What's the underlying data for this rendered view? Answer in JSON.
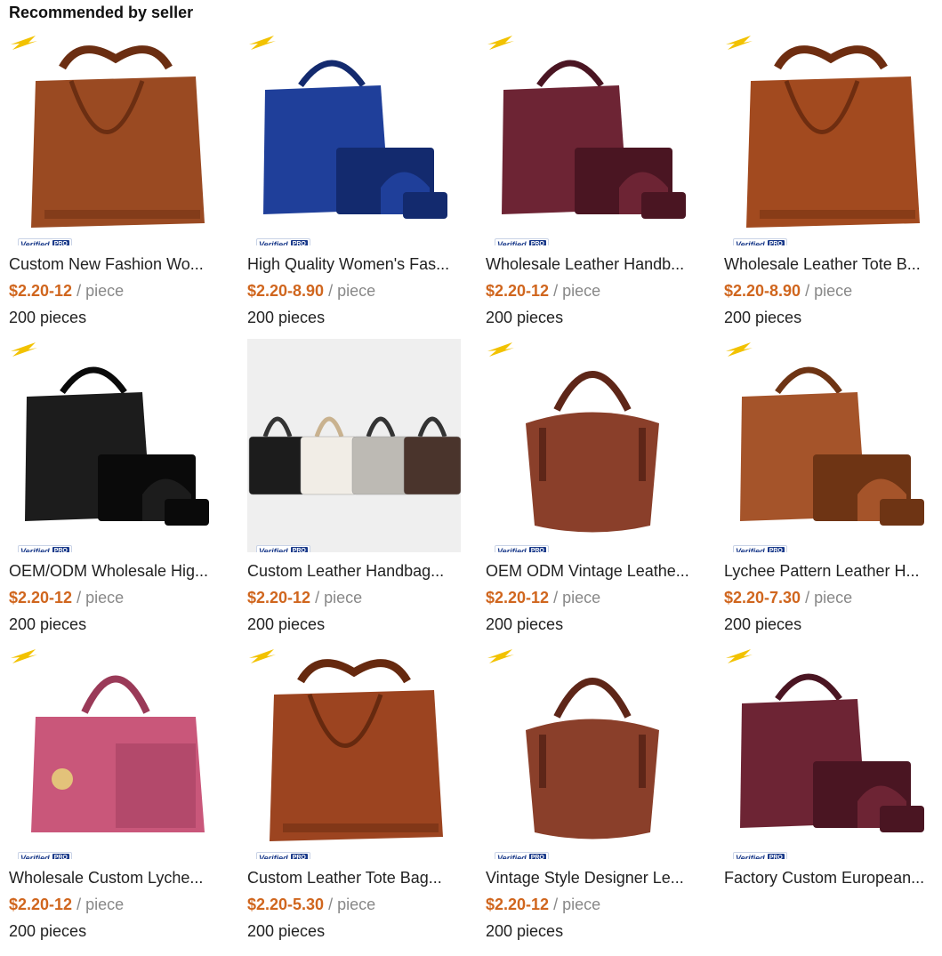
{
  "header": {
    "title": "Recommended by seller"
  },
  "verified": {
    "label": "Verified",
    "pro": "PRO"
  },
  "products": [
    {
      "title": "Custom New Fashion Wo...",
      "price": "$2.20-12",
      "unit": " / piece",
      "moq": "200 pieces",
      "art": "tote-brown",
      "bag_color": "#9a4a22",
      "bag_dark": "#6b2e12"
    },
    {
      "title": "High Quality Women's Fas...",
      "price": "$2.20-8.90",
      "unit": " / piece",
      "moq": "200 pieces",
      "art": "set-blue",
      "bag_color": "#1f3f9a",
      "bag_dark": "#132a6e"
    },
    {
      "title": "Wholesale Leather Handb...",
      "price": "$2.20-12",
      "unit": " / piece",
      "moq": "200 pieces",
      "art": "set-burgundy",
      "bag_color": "#6d2434",
      "bag_dark": "#4a1522"
    },
    {
      "title": "Wholesale Leather Tote B...",
      "price": "$2.20-8.90",
      "unit": " / piece",
      "moq": "200 pieces",
      "art": "tote-brown",
      "bag_color": "#a24a1f",
      "bag_dark": "#6e2d10"
    },
    {
      "title": "OEM/ODM Wholesale Hig...",
      "price": "$2.20-12",
      "unit": " / piece",
      "moq": "200 pieces",
      "art": "set-black",
      "bag_color": "#1c1c1c",
      "bag_dark": "#0a0a0a"
    },
    {
      "title": "Custom Leather Handbag...",
      "price": "$2.20-12",
      "unit": " / piece",
      "moq": "200 pieces",
      "art": "mini-bags",
      "bag_color": "#222222",
      "bag_dark": "#111111"
    },
    {
      "title": "OEM ODM Vintage Leathe...",
      "price": "$2.20-12",
      "unit": " / piece",
      "moq": "200 pieces",
      "art": "hobo-brown",
      "bag_color": "#8a3f2a",
      "bag_dark": "#5e2618"
    },
    {
      "title": "Lychee Pattern Leather H...",
      "price": "$2.20-7.30",
      "unit": " / piece",
      "moq": "200 pieces",
      "art": "set-brown",
      "bag_color": "#a5542a",
      "bag_dark": "#6e3414"
    },
    {
      "title": "Wholesale Custom Lyche...",
      "price": "$2.20-12",
      "unit": " / piece",
      "moq": "200 pieces",
      "art": "satchel-pink",
      "bag_color": "#c9577a",
      "bag_dark": "#9a3a58"
    },
    {
      "title": "Custom Leather Tote Bag...",
      "price": "$2.20-5.30",
      "unit": " / piece",
      "moq": "200 pieces",
      "art": "tote-brown",
      "bag_color": "#9c4420",
      "bag_dark": "#66290f"
    },
    {
      "title": "Vintage Style Designer Le...",
      "price": "$2.20-12",
      "unit": " / piece",
      "moq": "200 pieces",
      "art": "hobo-brown",
      "bag_color": "#8a3f2a",
      "bag_dark": "#5e2618"
    },
    {
      "title": "Factory Custom European...",
      "price": "",
      "unit": "",
      "moq": "",
      "art": "set-burgundy",
      "bag_color": "#6d2434",
      "bag_dark": "#4a1522"
    }
  ],
  "colors": {
    "price": "#d0661e",
    "unit": "#888888",
    "logo": "#f2c200",
    "verified": "#1a3a8a"
  }
}
